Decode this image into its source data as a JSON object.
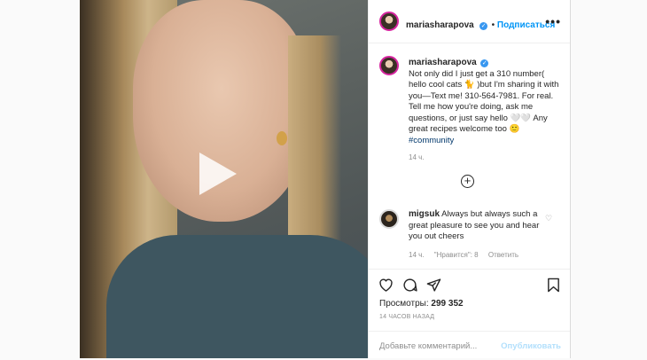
{
  "post": {
    "username": "mariasharapova",
    "follow_label": "Подписаться",
    "more_label": "•••",
    "caption": "Not only did I just get a 310 number( hello cool cats 🐈 )but I'm sharing it with you—Text me! 310-564-7981. For real. Tell me how you're doing, ask me questions, or just say hello 🤍🤍 Any great recipes welcome too 🙂",
    "hashtag": "#community",
    "caption_time": "14 ч.",
    "load_more": "+"
  },
  "comment": {
    "username": "migsuk",
    "text": "Always but always such a great pleasure to see you and hear you out cheers",
    "time": "14 ч.",
    "likes": "\"Нравится\": 8",
    "reply": "Ответить",
    "like_icon": "♡"
  },
  "actions": {
    "icons": [
      "heart-outline-icon",
      "comment-icon",
      "share-icon",
      "bookmark-icon"
    ],
    "views_label": "Просмотры:",
    "views_value": "299 352",
    "time_ago": "14 ЧАСОВ НАЗАД"
  },
  "add_comment": {
    "placeholder": "Добавьте комментарий...",
    "publish": "Опубликовать"
  },
  "colors": {
    "accent": "#0095f6",
    "verified": "#3897f0",
    "muted": "#8e8e8e"
  }
}
